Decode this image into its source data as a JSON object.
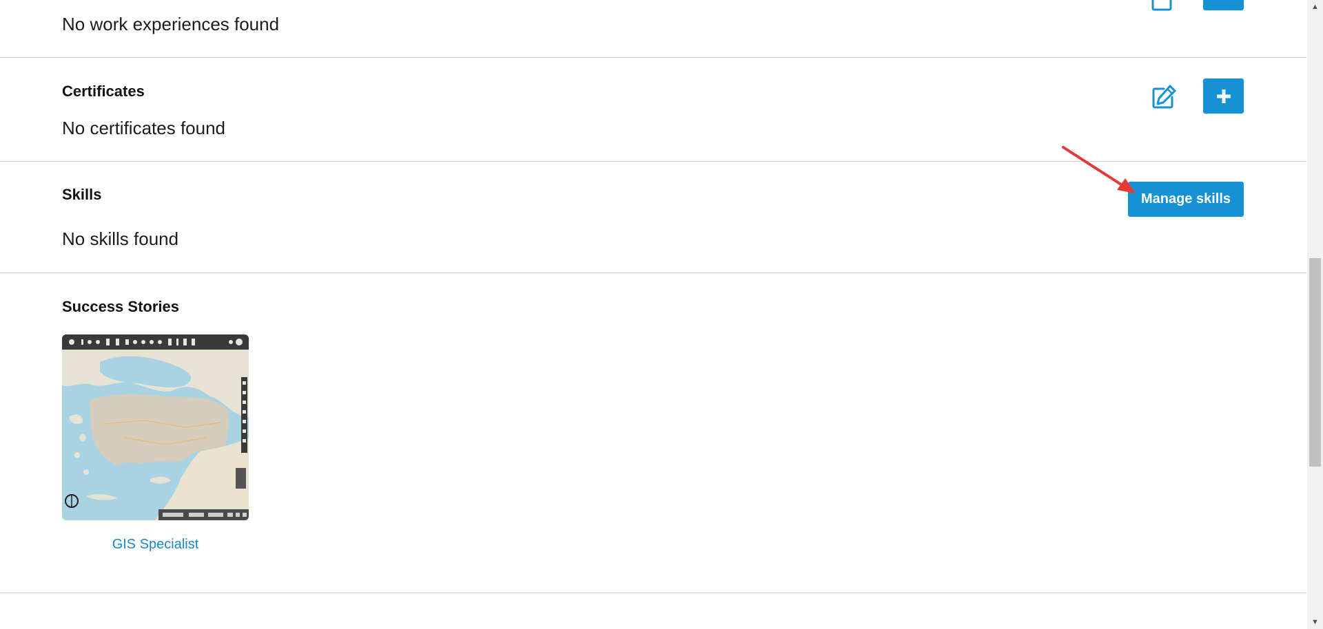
{
  "work": {
    "empty_text": "No work experiences found"
  },
  "certificates": {
    "title": "Certificates",
    "empty_text": "No certificates found"
  },
  "skills": {
    "title": "Skills",
    "empty_text": "No skills found",
    "manage_label": "Manage skills"
  },
  "stories": {
    "title": "Success Stories",
    "items": [
      {
        "label": "GIS Specialist"
      }
    ]
  },
  "icons": {
    "edit": "edit-icon",
    "add": "plus-icon"
  },
  "colors": {
    "primary": "#1592d6",
    "link": "#1788c6",
    "annotation_arrow": "#e53935"
  }
}
